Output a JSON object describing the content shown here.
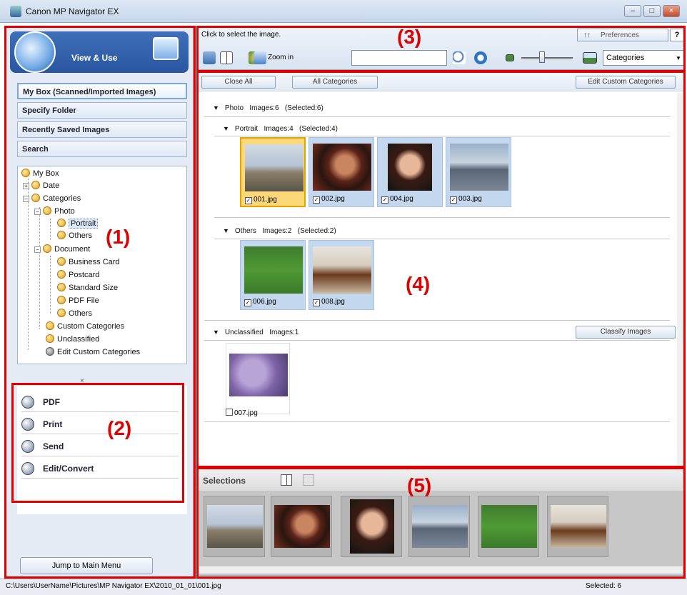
{
  "window": {
    "title": "Canon MP Navigator EX"
  },
  "left": {
    "mode_title": "View & Use",
    "nav": [
      "My Box (Scanned/Imported Images)",
      "Specify Folder",
      "Recently Saved Images",
      "Search"
    ],
    "tree": {
      "my_box": "My Box",
      "date": "Date",
      "categories": "Categories",
      "photo": "Photo",
      "portrait": "Portrait",
      "others_photo": "Others",
      "document": "Document",
      "business_card": "Business Card",
      "postcard": "Postcard",
      "standard_size": "Standard Size",
      "pdf_file": "PDF File",
      "others_doc": "Others",
      "custom_categories": "Custom Categories",
      "unclassified": "Unclassified",
      "edit_custom": "Edit Custom Categories"
    },
    "splitter_glyph": "×",
    "actions": [
      "PDF",
      "Print",
      "Send",
      "Edit/Convert"
    ],
    "jump_button": "Jump to Main Menu"
  },
  "toolbar": {
    "hint": "Click to select the image.",
    "preferences": "Preferences",
    "help": "?",
    "zoom_in": "Zoom in",
    "search_value": "",
    "view_select": "Categories",
    "slider_level": 0.4
  },
  "main": {
    "close_all": "Close All",
    "all_categories": "All Categories",
    "edit_custom_categories": "Edit Custom Categories",
    "classify_images": "Classify Images",
    "photo_group": {
      "name": "Photo",
      "images": "Images:6",
      "selected": "(Selected:6)"
    },
    "portrait_group": {
      "name": "Portrait",
      "images": "Images:4",
      "selected": "(Selected:4)"
    },
    "others_group": {
      "name": "Others",
      "images": "Images:2",
      "selected": "(Selected:2)"
    },
    "unclassified_group": {
      "name": "Unclassified",
      "images": "Images:1"
    },
    "portrait_files": [
      "001.jpg",
      "002.jpg",
      "004.jpg",
      "003.jpg"
    ],
    "others_files": [
      "006.jpg",
      "008.jpg"
    ],
    "unclassified_files": [
      "007.jpg"
    ],
    "check_glyph": "✓"
  },
  "selections": {
    "label": "Selections"
  },
  "status": {
    "path": "C:\\Users\\UserName\\Pictures\\MP Navigator EX\\2010_01_01\\001.jpg",
    "selected": "Selected: 6"
  },
  "callouts": [
    "(1)",
    "(2)",
    "(3)",
    "(4)",
    "(5)"
  ],
  "colors": {
    "callout_red": "#e10000",
    "selection_yellow": "#fcd879",
    "thumb_blue": "#c3d7ef"
  }
}
